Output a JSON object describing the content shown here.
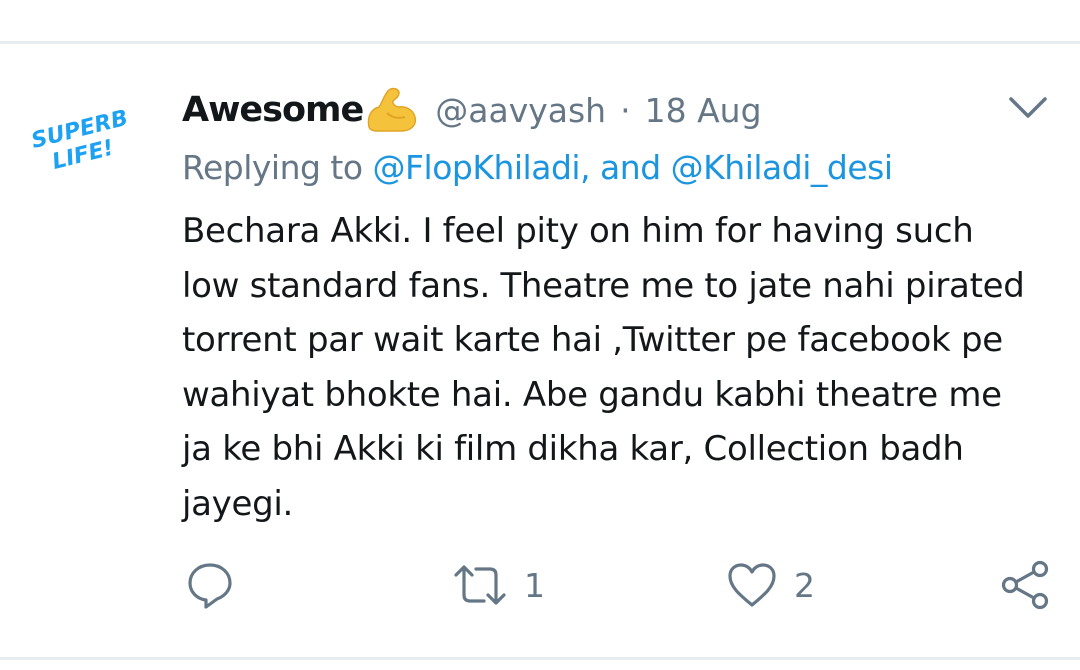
{
  "tweet": {
    "avatar_text_line1": "SUPERB",
    "avatar_text_line2": "LIFE!",
    "display_name": "Awesome",
    "handle": "@aavyash",
    "separator": "·",
    "date": "18 Aug",
    "reply_prefix": "Replying to ",
    "reply_mentions": [
      {
        "text": "@FlopKhiladi,"
      },
      {
        "text": " and "
      },
      {
        "text": "@Khiladi_desi"
      }
    ],
    "text": "Bechara Akki. I feel pity on him for having such\nlow standard fans. Theatre me to jate nahi pirated\ntorrent par wait karte hai ,Twitter pe facebook pe\nwahiyat bhokte hai. Abe gandu kabhi theatre me\nja ke bhi Akki ki film dikha kar, Collection badh\njayegi."
  },
  "actions": {
    "reply_icon": "reply-icon",
    "retweet_icon": "retweet-icon",
    "retweet_count": "1",
    "like_icon": "heart-icon",
    "like_count": "2",
    "share_icon": "share-icon"
  },
  "colors": {
    "text": "#14171a",
    "secondary": "#657786",
    "link": "#1b95e0",
    "avatar_text": "#1da1f2",
    "divider": "#e6ecf0"
  }
}
